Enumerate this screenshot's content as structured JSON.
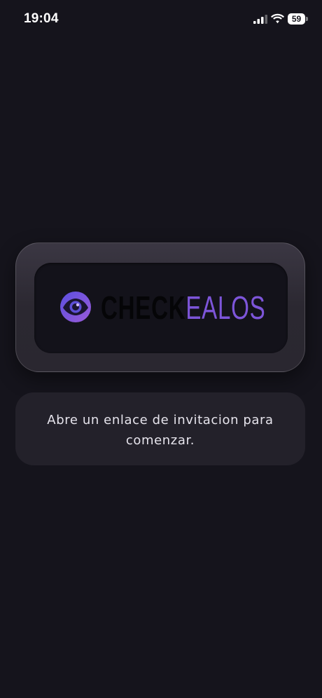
{
  "status_bar": {
    "time": "19:04",
    "battery_level": "59",
    "icons": [
      "signal-icon",
      "wifi-icon",
      "battery-icon"
    ]
  },
  "logo": {
    "text_primary": "CHECK",
    "text_accent": "EALOS",
    "icon": "eye-icon",
    "colors": {
      "accent": "#7d55d9",
      "primary_text": "#050507"
    }
  },
  "message": {
    "text": "Abre un enlace de invitacion para comenzar."
  },
  "theme": {
    "background": "#15141c",
    "card": "#23212a"
  }
}
